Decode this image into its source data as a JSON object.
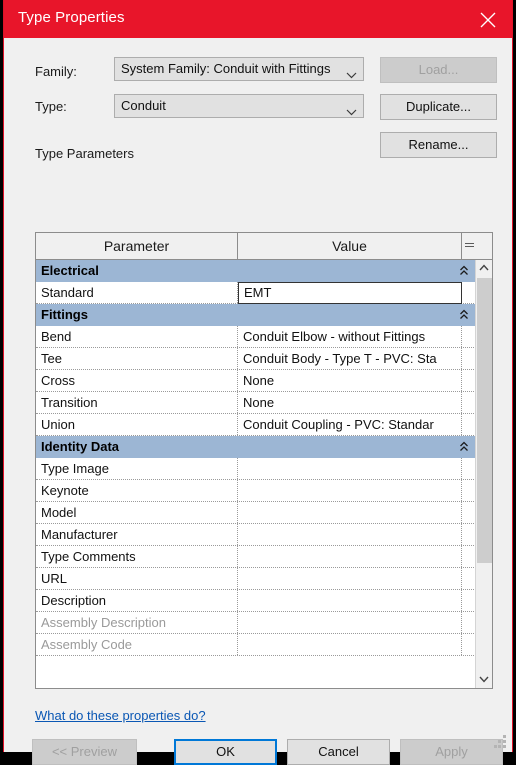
{
  "window": {
    "title": "Type Properties",
    "close_icon": "close-icon",
    "titlebar_color": "#e8152a"
  },
  "form": {
    "family_label": "Family:",
    "family_value": "System Family: Conduit with Fittings",
    "type_label": "Type:",
    "type_value": "Conduit",
    "load_button": "Load...",
    "duplicate_button": "Duplicate...",
    "rename_button": "Rename...",
    "section_label": "Type Parameters"
  },
  "table": {
    "columns": [
      "Parameter",
      "Value",
      "="
    ],
    "group_color": "#9cb6d4",
    "rows": [
      {
        "kind": "group",
        "name": "Electrical"
      },
      {
        "kind": "data",
        "name": "Standard",
        "value": "EMT",
        "editing": true,
        "readonly": false
      },
      {
        "kind": "group",
        "name": "Fittings"
      },
      {
        "kind": "data",
        "name": "Bend",
        "value": "Conduit Elbow - without Fittings",
        "editing": false,
        "readonly": false
      },
      {
        "kind": "data",
        "name": "Tee",
        "value": "Conduit Body - Type T - PVC: Sta",
        "editing": false,
        "readonly": false
      },
      {
        "kind": "data",
        "name": "Cross",
        "value": "None",
        "editing": false,
        "readonly": false
      },
      {
        "kind": "data",
        "name": "Transition",
        "value": "None",
        "editing": false,
        "readonly": false
      },
      {
        "kind": "data",
        "name": "Union",
        "value": "Conduit Coupling - PVC: Standar",
        "editing": false,
        "readonly": false
      },
      {
        "kind": "group",
        "name": "Identity Data"
      },
      {
        "kind": "data",
        "name": "Type Image",
        "value": "",
        "editing": false,
        "readonly": false
      },
      {
        "kind": "data",
        "name": "Keynote",
        "value": "",
        "editing": false,
        "readonly": false
      },
      {
        "kind": "data",
        "name": "Model",
        "value": "",
        "editing": false,
        "readonly": false
      },
      {
        "kind": "data",
        "name": "Manufacturer",
        "value": "",
        "editing": false,
        "readonly": false
      },
      {
        "kind": "data",
        "name": "Type Comments",
        "value": "",
        "editing": false,
        "readonly": false
      },
      {
        "kind": "data",
        "name": "URL",
        "value": "",
        "editing": false,
        "readonly": false
      },
      {
        "kind": "data",
        "name": "Description",
        "value": "",
        "editing": false,
        "readonly": false
      },
      {
        "kind": "data",
        "name": "Assembly Description",
        "value": "",
        "editing": false,
        "readonly": true
      },
      {
        "kind": "data",
        "name": "Assembly Code",
        "value": "",
        "editing": false,
        "readonly": true
      }
    ]
  },
  "footer": {
    "help_link": "What do these properties do?",
    "preview_button": "<< Preview",
    "ok_button": "OK",
    "cancel_button": "Cancel",
    "apply_button": "Apply"
  }
}
